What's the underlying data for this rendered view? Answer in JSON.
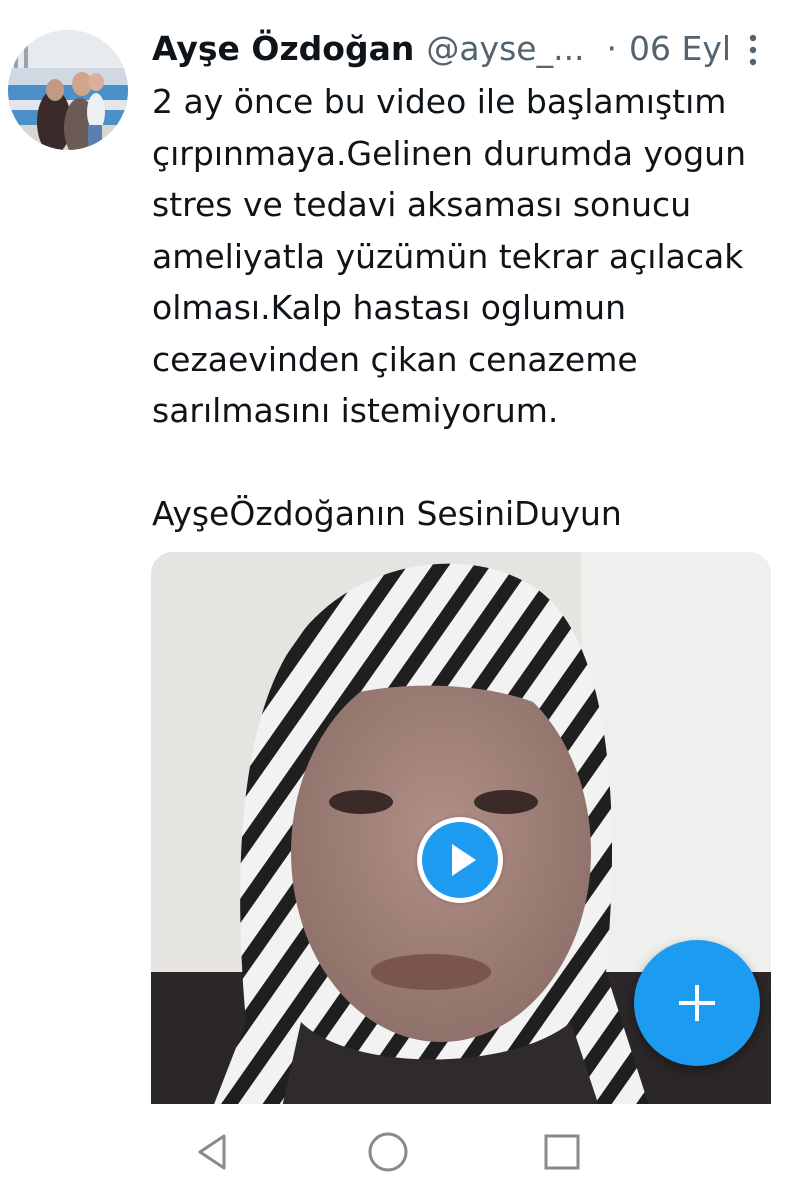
{
  "tweet": {
    "author_name": "Ayşe Özdoğan",
    "author_handle": "@ayse_...",
    "separator": "·",
    "date": "06 Eyl",
    "text_lines": [
      "2 ay önce bu video ile başlamıştım",
      "çırpınmaya.Gelinen durumda yogun",
      "stres ve tedavi aksaması sonucu",
      "ameliyatla yüzümün tekrar açılacak",
      "olması.Kalp hastası oglumun",
      "cezaevinden çikan cenazeme",
      "sarılmasını istemiyorum."
    ],
    "hashtag_line": "AyşeÖzdoğanın SesiniDuyun"
  },
  "icons": {
    "more": "more-vertical-icon",
    "play": "play-icon",
    "compose": "plus-icon",
    "nav_back": "back-triangle-icon",
    "nav_home": "home-circle-icon",
    "nav_recents": "recents-square-icon"
  },
  "colors": {
    "accent": "#1d9bf0",
    "text_primary": "#0f1419",
    "text_secondary": "#536471",
    "nav_icon": "#8a8a8a"
  }
}
